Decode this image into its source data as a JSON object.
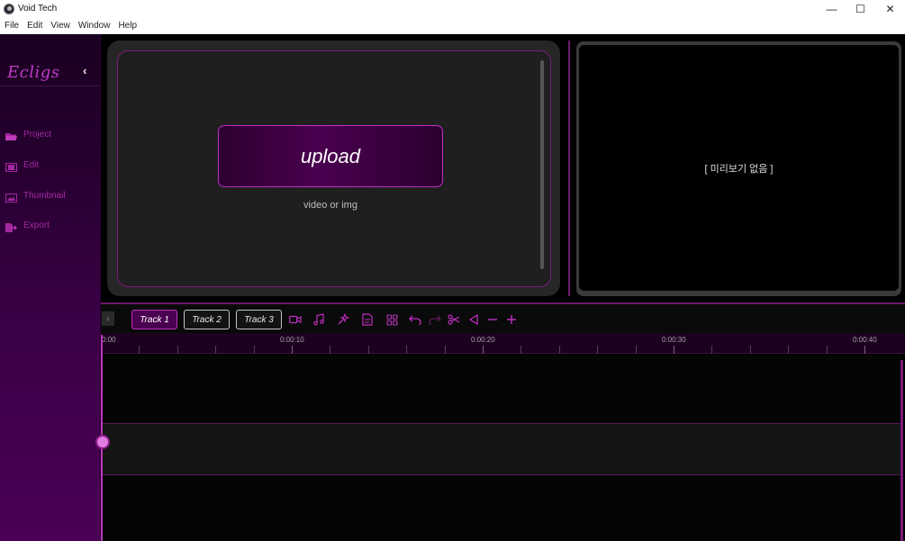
{
  "window": {
    "title": "Void Tech",
    "controls": {
      "minimize": "—",
      "maximize": "☐",
      "close": "✕"
    }
  },
  "menu": {
    "items": [
      "File",
      "Edit",
      "View",
      "Window",
      "Help"
    ]
  },
  "sidebar": {
    "logo": "Ecligs",
    "collapse_glyph": "‹",
    "items": [
      {
        "label": "Project",
        "icon": "folder-icon"
      },
      {
        "label": "Edit",
        "icon": "film-icon"
      },
      {
        "label": "Thumbnail",
        "icon": "image-icon"
      },
      {
        "label": "Export",
        "icon": "export-icon"
      }
    ]
  },
  "upload": {
    "button_label": "upload",
    "hint": "video or img"
  },
  "preview": {
    "placeholder": "[ 미리보기 없음 ]"
  },
  "toolbar": {
    "back_glyph": "‹",
    "tracks": [
      "Track 1",
      "Track 2",
      "Track 3"
    ],
    "active_track": "Track 1",
    "tools": [
      "video-icon",
      "music-icon",
      "effects-icon",
      "subtitle-icon",
      "grid-icon",
      "undo-icon",
      "redo-icon",
      "cut-icon",
      "marker-icon",
      "zoom-out-icon",
      "zoom-in-icon"
    ]
  },
  "timeline": {
    "ruler_labels": [
      "0:00",
      "0:00:10",
      "0:00:20",
      "0:00:30",
      "0:00:40"
    ]
  },
  "colors": {
    "accent": "#c02ec2",
    "sidebar_label": "#a3279f",
    "panel": "#262626"
  }
}
